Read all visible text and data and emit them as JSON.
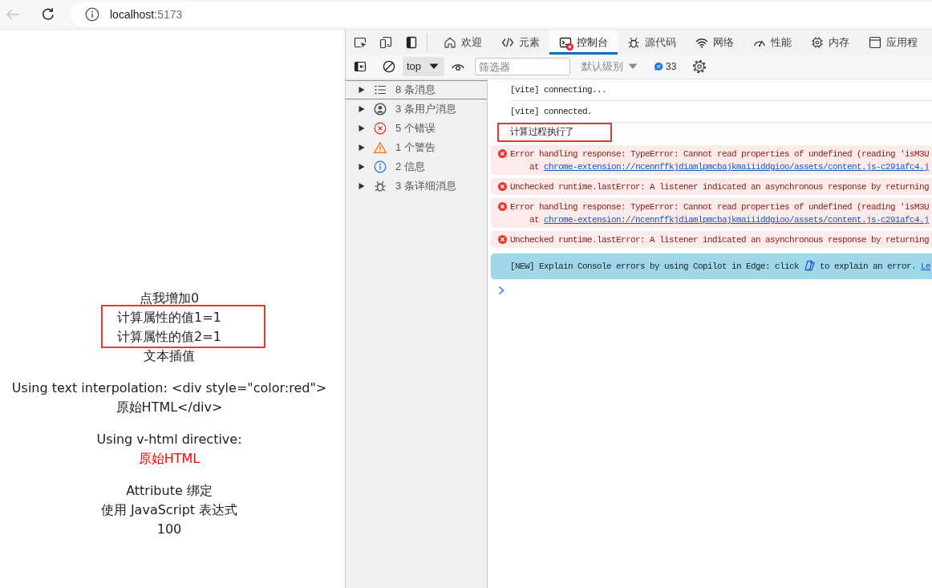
{
  "browser": {
    "back": {
      "disabled": true
    },
    "address": {
      "host": "localhost",
      "port": ":5173"
    }
  },
  "page": {
    "sections": [
      {
        "groups": [
          {
            "highlighted": false,
            "lines": [
              {
                "kind": "action",
                "text": "点我增加0"
              }
            ]
          },
          {
            "highlighted": true,
            "lines": [
              {
                "kind": "text",
                "text": "计算属性的值1=1"
              },
              {
                "kind": "text",
                "text": "计算属性的值2=1"
              }
            ]
          },
          {
            "highlighted": false,
            "lines": [
              {
                "kind": "text",
                "text": "文本插值"
              }
            ]
          }
        ]
      },
      {
        "groups": [
          {
            "highlighted": false,
            "lines": [
              {
                "kind": "text",
                "text": "Using text interpolation: <div style=\"color:red\">原始HTML</div>"
              }
            ]
          }
        ]
      },
      {
        "groups": [
          {
            "highlighted": false,
            "lines": [
              {
                "kind": "text",
                "text": "Using v-html directive:"
              },
              {
                "kind": "html",
                "text": "原始HTML"
              }
            ]
          }
        ]
      },
      {
        "groups": [
          {
            "highlighted": false,
            "lines": [
              {
                "kind": "text",
                "text": "Attribute 绑定"
              },
              {
                "kind": "text",
                "text": "使用 JavaScript 表达式"
              },
              {
                "kind": "text",
                "text": "100"
              }
            ]
          }
        ]
      }
    ]
  },
  "devtools": {
    "tabs": [
      {
        "kind": "welcome",
        "label": "欢迎",
        "selected": false,
        "errors": false
      },
      {
        "kind": "elements",
        "label": "元素",
        "selected": false,
        "errors": false
      },
      {
        "kind": "console",
        "label": "控制台",
        "selected": true,
        "errors": true
      },
      {
        "kind": "sources",
        "label": "源代码",
        "selected": false,
        "errors": false
      },
      {
        "kind": "network",
        "label": "网络",
        "selected": false,
        "errors": false
      },
      {
        "kind": "performance",
        "label": "性能",
        "selected": false,
        "errors": false
      },
      {
        "kind": "memory",
        "label": "内存",
        "selected": false,
        "errors": false
      },
      {
        "kind": "application",
        "label": "应用程",
        "selected": false,
        "errors": false
      }
    ],
    "toolbar": {
      "context": "top",
      "filter": {
        "placeholder": "筛选器"
      },
      "levels": "默认级别",
      "count": "33"
    },
    "sidebar": {
      "items": [
        {
          "kind": "all",
          "label": "8 条消息",
          "selected": true,
          "expanded": false
        },
        {
          "kind": "user",
          "label": "3 条用户消息",
          "selected": false,
          "expanded": false
        },
        {
          "kind": "error",
          "label": "5 个错误",
          "selected": false,
          "expanded": false
        },
        {
          "kind": "warning",
          "label": "1 个警告",
          "selected": false,
          "expanded": false
        },
        {
          "kind": "info",
          "label": "2 信息",
          "selected": false,
          "expanded": false
        },
        {
          "kind": "verbose",
          "label": "3 条详细消息",
          "selected": false,
          "expanded": false
        }
      ]
    },
    "console": {
      "messages": [
        {
          "kind": "log",
          "text": "[vite] connecting...",
          "highlighted": false
        },
        {
          "kind": "log",
          "text": "[vite] connected.",
          "highlighted": false
        },
        {
          "kind": "log",
          "text": "计算过程执行了",
          "highlighted": true
        },
        {
          "kind": "error",
          "text": "Error handling response: TypeError: Cannot read properties of undefined (reading 'isM3U",
          "stack": {
            "prefix": "at",
            "link": "chrome-extension://ncennffkjdiamlpmcbajkmaiiiddgioo/assets/content.js-c291afc4.j"
          },
          "highlighted": false
        },
        {
          "kind": "error",
          "text": "Unchecked runtime.lastError: A listener indicated an asynchronous response by returning",
          "highlighted": false
        },
        {
          "kind": "error",
          "text": "Error handling response: TypeError: Cannot read properties of undefined (reading 'isM3U",
          "stack": {
            "prefix": "at",
            "link": "chrome-extension://ncennffkjdiamlpmcbajkmaiiiddgioo/assets/content.js-c291afc4.j"
          },
          "highlighted": false
        },
        {
          "kind": "error",
          "text": "Unchecked runtime.lastError: A listener indicated an asynchronous response by returning",
          "highlighted": false
        },
        {
          "kind": "notice",
          "text": "[NEW] Explain Console errors by using Copilot in Edge: click",
          "after": "to explain an error.",
          "link": "Le",
          "highlighted": false
        }
      ]
    }
  }
}
